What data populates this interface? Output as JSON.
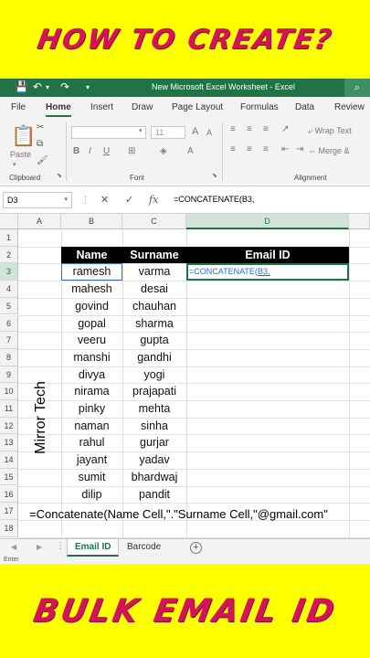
{
  "banner": {
    "top": "HOW TO CREATE?",
    "bottom": "BULK EMAIL ID"
  },
  "app": {
    "title": "New Microsoft Excel Worksheet  -  Excel"
  },
  "ribbon": {
    "tabs": [
      "File",
      "Home",
      "Insert",
      "Draw",
      "Page Layout",
      "Formulas",
      "Data",
      "Review"
    ],
    "active_tab": "Home",
    "paste_label": "Paste",
    "font_size": "11",
    "wrap_text": "Wrap Text",
    "merge_center": "Merge &",
    "groups": {
      "clipboard": "Clipboard",
      "font": "Font",
      "alignment": "Alignment"
    }
  },
  "formula_bar": {
    "name_box": "D3",
    "formula": "=CONCATENATE(B3,"
  },
  "grid": {
    "columns": [
      "A",
      "B",
      "C",
      "D"
    ],
    "rows": [
      "1",
      "2",
      "3",
      "4",
      "5",
      "6",
      "7",
      "8",
      "9",
      "10",
      "11",
      "12",
      "13",
      "14",
      "15",
      "16",
      "17",
      "18"
    ],
    "headers": {
      "name": "Name",
      "surname": "Surname",
      "email": "Email ID"
    },
    "names": [
      "ramesh",
      "mahesh",
      "govind",
      "gopal",
      "veeru",
      "manshi",
      "divya",
      "nirama",
      "pinky",
      "naman",
      "rahul",
      "jayant",
      "sumit",
      "dilip"
    ],
    "surnames": [
      "varma",
      "desai",
      "chauhan",
      "sharma",
      "gupta",
      "gandhi",
      "yogi",
      "prajapati",
      "mehta",
      "sinha",
      "gurjar",
      "yadav",
      "bhardwaj",
      "pandit"
    ],
    "active_cell_text": "=CONCATENATE(",
    "active_cell_ref": "B3,"
  },
  "overlay": {
    "watermark": "Mirror Tech",
    "formula_hint": "=Concatenate(Name Cell,\".\"Surname Cell,\"@gmail.com\""
  },
  "sheets": {
    "tabs": [
      "Email ID",
      "Barcode"
    ],
    "active": "Email ID",
    "add_icon": "plus-icon"
  },
  "status": {
    "mode": "Enter"
  },
  "colors": {
    "excel_green": "#217346",
    "banner_bg": "#ffff00",
    "banner_text": "#d4145a"
  }
}
